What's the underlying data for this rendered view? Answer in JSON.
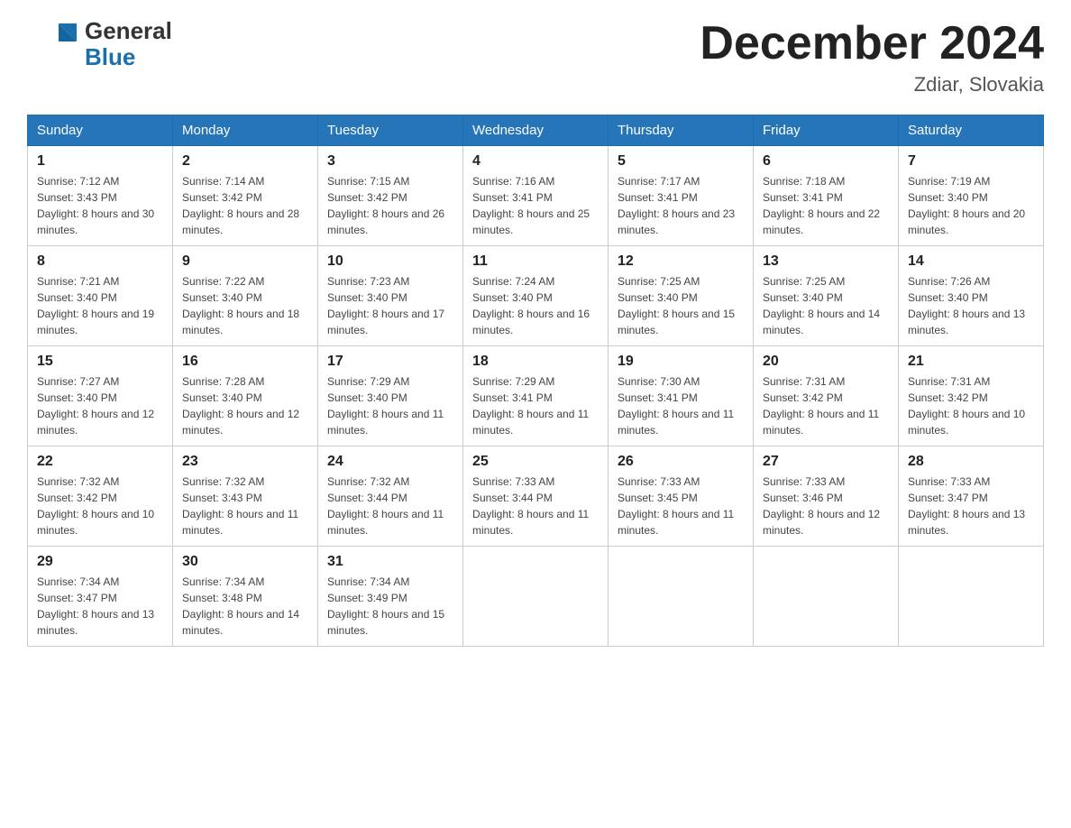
{
  "header": {
    "logo": {
      "general": "General",
      "blue": "Blue",
      "alt": "GeneralBlue logo"
    },
    "title": "December 2024",
    "location": "Zdiar, Slovakia"
  },
  "days_of_week": [
    "Sunday",
    "Monday",
    "Tuesday",
    "Wednesday",
    "Thursday",
    "Friday",
    "Saturday"
  ],
  "weeks": [
    [
      {
        "day": "1",
        "sunrise": "7:12 AM",
        "sunset": "3:43 PM",
        "daylight": "8 hours and 30 minutes."
      },
      {
        "day": "2",
        "sunrise": "7:14 AM",
        "sunset": "3:42 PM",
        "daylight": "8 hours and 28 minutes."
      },
      {
        "day": "3",
        "sunrise": "7:15 AM",
        "sunset": "3:42 PM",
        "daylight": "8 hours and 26 minutes."
      },
      {
        "day": "4",
        "sunrise": "7:16 AM",
        "sunset": "3:41 PM",
        "daylight": "8 hours and 25 minutes."
      },
      {
        "day": "5",
        "sunrise": "7:17 AM",
        "sunset": "3:41 PM",
        "daylight": "8 hours and 23 minutes."
      },
      {
        "day": "6",
        "sunrise": "7:18 AM",
        "sunset": "3:41 PM",
        "daylight": "8 hours and 22 minutes."
      },
      {
        "day": "7",
        "sunrise": "7:19 AM",
        "sunset": "3:40 PM",
        "daylight": "8 hours and 20 minutes."
      }
    ],
    [
      {
        "day": "8",
        "sunrise": "7:21 AM",
        "sunset": "3:40 PM",
        "daylight": "8 hours and 19 minutes."
      },
      {
        "day": "9",
        "sunrise": "7:22 AM",
        "sunset": "3:40 PM",
        "daylight": "8 hours and 18 minutes."
      },
      {
        "day": "10",
        "sunrise": "7:23 AM",
        "sunset": "3:40 PM",
        "daylight": "8 hours and 17 minutes."
      },
      {
        "day": "11",
        "sunrise": "7:24 AM",
        "sunset": "3:40 PM",
        "daylight": "8 hours and 16 minutes."
      },
      {
        "day": "12",
        "sunrise": "7:25 AM",
        "sunset": "3:40 PM",
        "daylight": "8 hours and 15 minutes."
      },
      {
        "day": "13",
        "sunrise": "7:25 AM",
        "sunset": "3:40 PM",
        "daylight": "8 hours and 14 minutes."
      },
      {
        "day": "14",
        "sunrise": "7:26 AM",
        "sunset": "3:40 PM",
        "daylight": "8 hours and 13 minutes."
      }
    ],
    [
      {
        "day": "15",
        "sunrise": "7:27 AM",
        "sunset": "3:40 PM",
        "daylight": "8 hours and 12 minutes."
      },
      {
        "day": "16",
        "sunrise": "7:28 AM",
        "sunset": "3:40 PM",
        "daylight": "8 hours and 12 minutes."
      },
      {
        "day": "17",
        "sunrise": "7:29 AM",
        "sunset": "3:40 PM",
        "daylight": "8 hours and 11 minutes."
      },
      {
        "day": "18",
        "sunrise": "7:29 AM",
        "sunset": "3:41 PM",
        "daylight": "8 hours and 11 minutes."
      },
      {
        "day": "19",
        "sunrise": "7:30 AM",
        "sunset": "3:41 PM",
        "daylight": "8 hours and 11 minutes."
      },
      {
        "day": "20",
        "sunrise": "7:31 AM",
        "sunset": "3:42 PM",
        "daylight": "8 hours and 11 minutes."
      },
      {
        "day": "21",
        "sunrise": "7:31 AM",
        "sunset": "3:42 PM",
        "daylight": "8 hours and 10 minutes."
      }
    ],
    [
      {
        "day": "22",
        "sunrise": "7:32 AM",
        "sunset": "3:42 PM",
        "daylight": "8 hours and 10 minutes."
      },
      {
        "day": "23",
        "sunrise": "7:32 AM",
        "sunset": "3:43 PM",
        "daylight": "8 hours and 11 minutes."
      },
      {
        "day": "24",
        "sunrise": "7:32 AM",
        "sunset": "3:44 PM",
        "daylight": "8 hours and 11 minutes."
      },
      {
        "day": "25",
        "sunrise": "7:33 AM",
        "sunset": "3:44 PM",
        "daylight": "8 hours and 11 minutes."
      },
      {
        "day": "26",
        "sunrise": "7:33 AM",
        "sunset": "3:45 PM",
        "daylight": "8 hours and 11 minutes."
      },
      {
        "day": "27",
        "sunrise": "7:33 AM",
        "sunset": "3:46 PM",
        "daylight": "8 hours and 12 minutes."
      },
      {
        "day": "28",
        "sunrise": "7:33 AM",
        "sunset": "3:47 PM",
        "daylight": "8 hours and 13 minutes."
      }
    ],
    [
      {
        "day": "29",
        "sunrise": "7:34 AM",
        "sunset": "3:47 PM",
        "daylight": "8 hours and 13 minutes."
      },
      {
        "day": "30",
        "sunrise": "7:34 AM",
        "sunset": "3:48 PM",
        "daylight": "8 hours and 14 minutes."
      },
      {
        "day": "31",
        "sunrise": "7:34 AM",
        "sunset": "3:49 PM",
        "daylight": "8 hours and 15 minutes."
      },
      null,
      null,
      null,
      null
    ]
  ],
  "labels": {
    "sunrise": "Sunrise:",
    "sunset": "Sunset:",
    "daylight": "Daylight:"
  }
}
